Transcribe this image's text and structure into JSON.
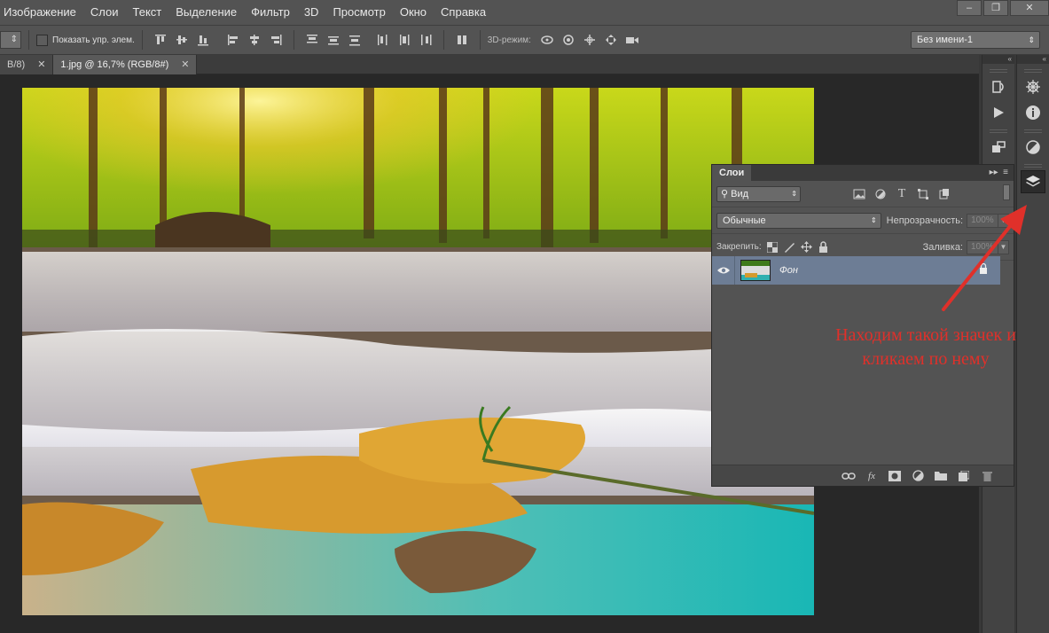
{
  "menubar": {
    "items": [
      "Изображение",
      "Слои",
      "Текст",
      "Выделение",
      "Фильтр",
      "3D",
      "Просмотр",
      "Окно",
      "Справка"
    ]
  },
  "options_bar": {
    "show_controls_label": "Показать упр. элем.",
    "mode_3d_label": "3D-режим:",
    "workspace_value": "Без имени-1"
  },
  "tabs": [
    {
      "label": "B/8)"
    },
    {
      "label": "1.jpg @ 16,7% (RGB/8#)"
    }
  ],
  "layers_panel": {
    "title": "Слои",
    "filter_value": "Вид",
    "blend_mode": "Обычные",
    "opacity_label": "Непрозрачность:",
    "opacity_value": "100%",
    "lock_label": "Закрепить:",
    "fill_label": "Заливка:",
    "fill_value": "100%",
    "layers": [
      {
        "name": "Фон"
      }
    ]
  },
  "annotation": {
    "line1": "Находим такой значек и",
    "line2": "кликаем по нему",
    "color": "#e0302a"
  }
}
